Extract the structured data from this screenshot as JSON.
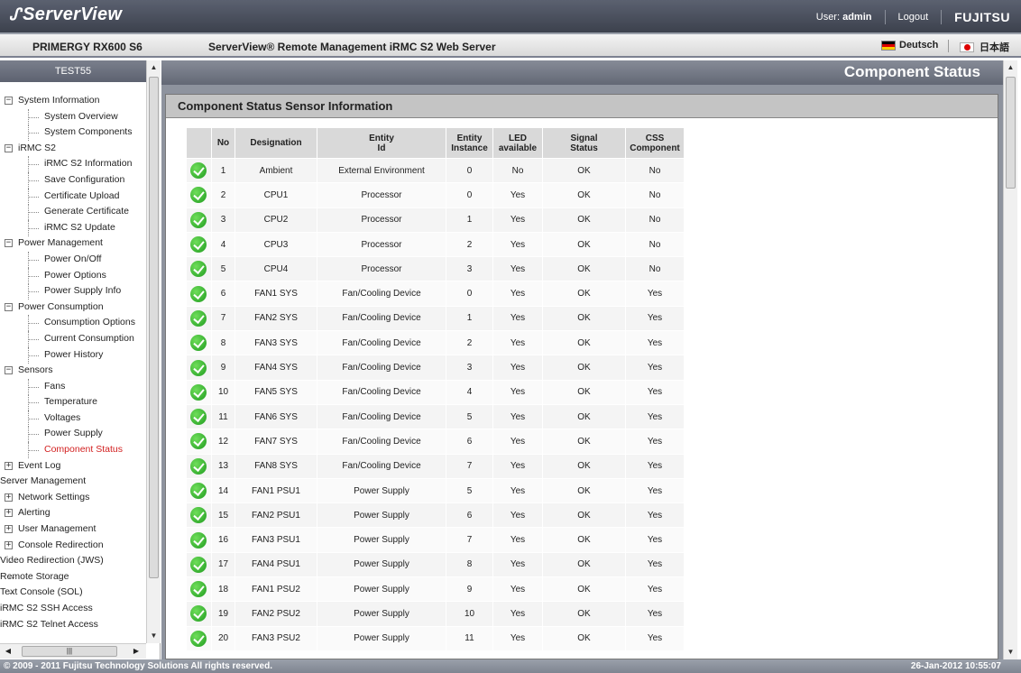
{
  "header": {
    "logo": "ServerView",
    "user_label": "User:",
    "user_name": "admin",
    "logout": "Logout",
    "brand": "FUJITSU"
  },
  "subbar": {
    "model": "PRIMERGY RX600 S6",
    "product": "ServerView® Remote Management iRMC S2 Web Server",
    "lang_de": "Deutsch",
    "lang_jp": "日本語"
  },
  "sidebar": {
    "host": "TEST55",
    "tree": [
      {
        "label": "System Information",
        "level": "top",
        "expander": "−"
      },
      {
        "label": "System Overview",
        "level": "child"
      },
      {
        "label": "System Components",
        "level": "child"
      },
      {
        "label": "iRMC S2",
        "level": "top",
        "expander": "−"
      },
      {
        "label": "iRMC S2 Information",
        "level": "child"
      },
      {
        "label": "Save Configuration",
        "level": "child"
      },
      {
        "label": "Certificate Upload",
        "level": "child"
      },
      {
        "label": "Generate Certificate",
        "level": "child"
      },
      {
        "label": "iRMC S2 Update",
        "level": "child"
      },
      {
        "label": "Power Management",
        "level": "top",
        "expander": "−"
      },
      {
        "label": "Power On/Off",
        "level": "child"
      },
      {
        "label": "Power Options",
        "level": "child"
      },
      {
        "label": "Power Supply Info",
        "level": "child"
      },
      {
        "label": "Power Consumption",
        "level": "top",
        "expander": "−"
      },
      {
        "label": "Consumption Options",
        "level": "child"
      },
      {
        "label": "Current Consumption",
        "level": "child"
      },
      {
        "label": "Power History",
        "level": "child"
      },
      {
        "label": "Sensors",
        "level": "top",
        "expander": "−"
      },
      {
        "label": "Fans",
        "level": "child"
      },
      {
        "label": "Temperature",
        "level": "child"
      },
      {
        "label": "Voltages",
        "level": "child"
      },
      {
        "label": "Power Supply",
        "level": "child"
      },
      {
        "label": "Component Status",
        "level": "child",
        "active": true
      },
      {
        "label": "Event Log",
        "level": "top",
        "expander": "+"
      },
      {
        "label": "Server Management",
        "level": "leaf"
      },
      {
        "label": "Network Settings",
        "level": "top",
        "expander": "+"
      },
      {
        "label": "Alerting",
        "level": "top",
        "expander": "+"
      },
      {
        "label": "User Management",
        "level": "top",
        "expander": "+"
      },
      {
        "label": "Console Redirection",
        "level": "top",
        "expander": "+"
      },
      {
        "label": "Video Redirection (JWS)",
        "level": "leaf"
      },
      {
        "label": "Remote Storage",
        "level": "leaf"
      },
      {
        "label": "Text Console (SOL)",
        "level": "leaf"
      },
      {
        "label": "iRMC S2 SSH Access",
        "level": "leaf"
      },
      {
        "label": "iRMC S2 Telnet Access",
        "level": "leaf"
      }
    ]
  },
  "main": {
    "page_title": "Component Status",
    "panel_title": "Component Status Sensor Information",
    "columns": [
      "",
      "No",
      "Designation",
      "Entity\nId",
      "Entity\nInstance",
      "LED\navailable",
      "Signal\nStatus",
      "CSS\nComponent"
    ],
    "rows": [
      {
        "no": "1",
        "designation": "Ambient",
        "entity_id": "External Environment",
        "instance": "0",
        "led": "No",
        "signal": "OK",
        "css": "No"
      },
      {
        "no": "2",
        "designation": "CPU1",
        "entity_id": "Processor",
        "instance": "0",
        "led": "Yes",
        "signal": "OK",
        "css": "No"
      },
      {
        "no": "3",
        "designation": "CPU2",
        "entity_id": "Processor",
        "instance": "1",
        "led": "Yes",
        "signal": "OK",
        "css": "No"
      },
      {
        "no": "4",
        "designation": "CPU3",
        "entity_id": "Processor",
        "instance": "2",
        "led": "Yes",
        "signal": "OK",
        "css": "No"
      },
      {
        "no": "5",
        "designation": "CPU4",
        "entity_id": "Processor",
        "instance": "3",
        "led": "Yes",
        "signal": "OK",
        "css": "No"
      },
      {
        "no": "6",
        "designation": "FAN1 SYS",
        "entity_id": "Fan/Cooling Device",
        "instance": "0",
        "led": "Yes",
        "signal": "OK",
        "css": "Yes"
      },
      {
        "no": "7",
        "designation": "FAN2 SYS",
        "entity_id": "Fan/Cooling Device",
        "instance": "1",
        "led": "Yes",
        "signal": "OK",
        "css": "Yes"
      },
      {
        "no": "8",
        "designation": "FAN3 SYS",
        "entity_id": "Fan/Cooling Device",
        "instance": "2",
        "led": "Yes",
        "signal": "OK",
        "css": "Yes"
      },
      {
        "no": "9",
        "designation": "FAN4 SYS",
        "entity_id": "Fan/Cooling Device",
        "instance": "3",
        "led": "Yes",
        "signal": "OK",
        "css": "Yes"
      },
      {
        "no": "10",
        "designation": "FAN5 SYS",
        "entity_id": "Fan/Cooling Device",
        "instance": "4",
        "led": "Yes",
        "signal": "OK",
        "css": "Yes"
      },
      {
        "no": "11",
        "designation": "FAN6 SYS",
        "entity_id": "Fan/Cooling Device",
        "instance": "5",
        "led": "Yes",
        "signal": "OK",
        "css": "Yes"
      },
      {
        "no": "12",
        "designation": "FAN7 SYS",
        "entity_id": "Fan/Cooling Device",
        "instance": "6",
        "led": "Yes",
        "signal": "OK",
        "css": "Yes"
      },
      {
        "no": "13",
        "designation": "FAN8 SYS",
        "entity_id": "Fan/Cooling Device",
        "instance": "7",
        "led": "Yes",
        "signal": "OK",
        "css": "Yes"
      },
      {
        "no": "14",
        "designation": "FAN1 PSU1",
        "entity_id": "Power Supply",
        "instance": "5",
        "led": "Yes",
        "signal": "OK",
        "css": "Yes"
      },
      {
        "no": "15",
        "designation": "FAN2 PSU1",
        "entity_id": "Power Supply",
        "instance": "6",
        "led": "Yes",
        "signal": "OK",
        "css": "Yes"
      },
      {
        "no": "16",
        "designation": "FAN3 PSU1",
        "entity_id": "Power Supply",
        "instance": "7",
        "led": "Yes",
        "signal": "OK",
        "css": "Yes"
      },
      {
        "no": "17",
        "designation": "FAN4 PSU1",
        "entity_id": "Power Supply",
        "instance": "8",
        "led": "Yes",
        "signal": "OK",
        "css": "Yes"
      },
      {
        "no": "18",
        "designation": "FAN1 PSU2",
        "entity_id": "Power Supply",
        "instance": "9",
        "led": "Yes",
        "signal": "OK",
        "css": "Yes"
      },
      {
        "no": "19",
        "designation": "FAN2 PSU2",
        "entity_id": "Power Supply",
        "instance": "10",
        "led": "Yes",
        "signal": "OK",
        "css": "Yes"
      },
      {
        "no": "20",
        "designation": "FAN3 PSU2",
        "entity_id": "Power Supply",
        "instance": "11",
        "led": "Yes",
        "signal": "OK",
        "css": "Yes"
      }
    ]
  },
  "footer": {
    "copyright": "© 2009 - 2011 Fujitsu Technology Solutions All rights reserved.",
    "datetime": "26-Jan-2012 10:55:07"
  }
}
